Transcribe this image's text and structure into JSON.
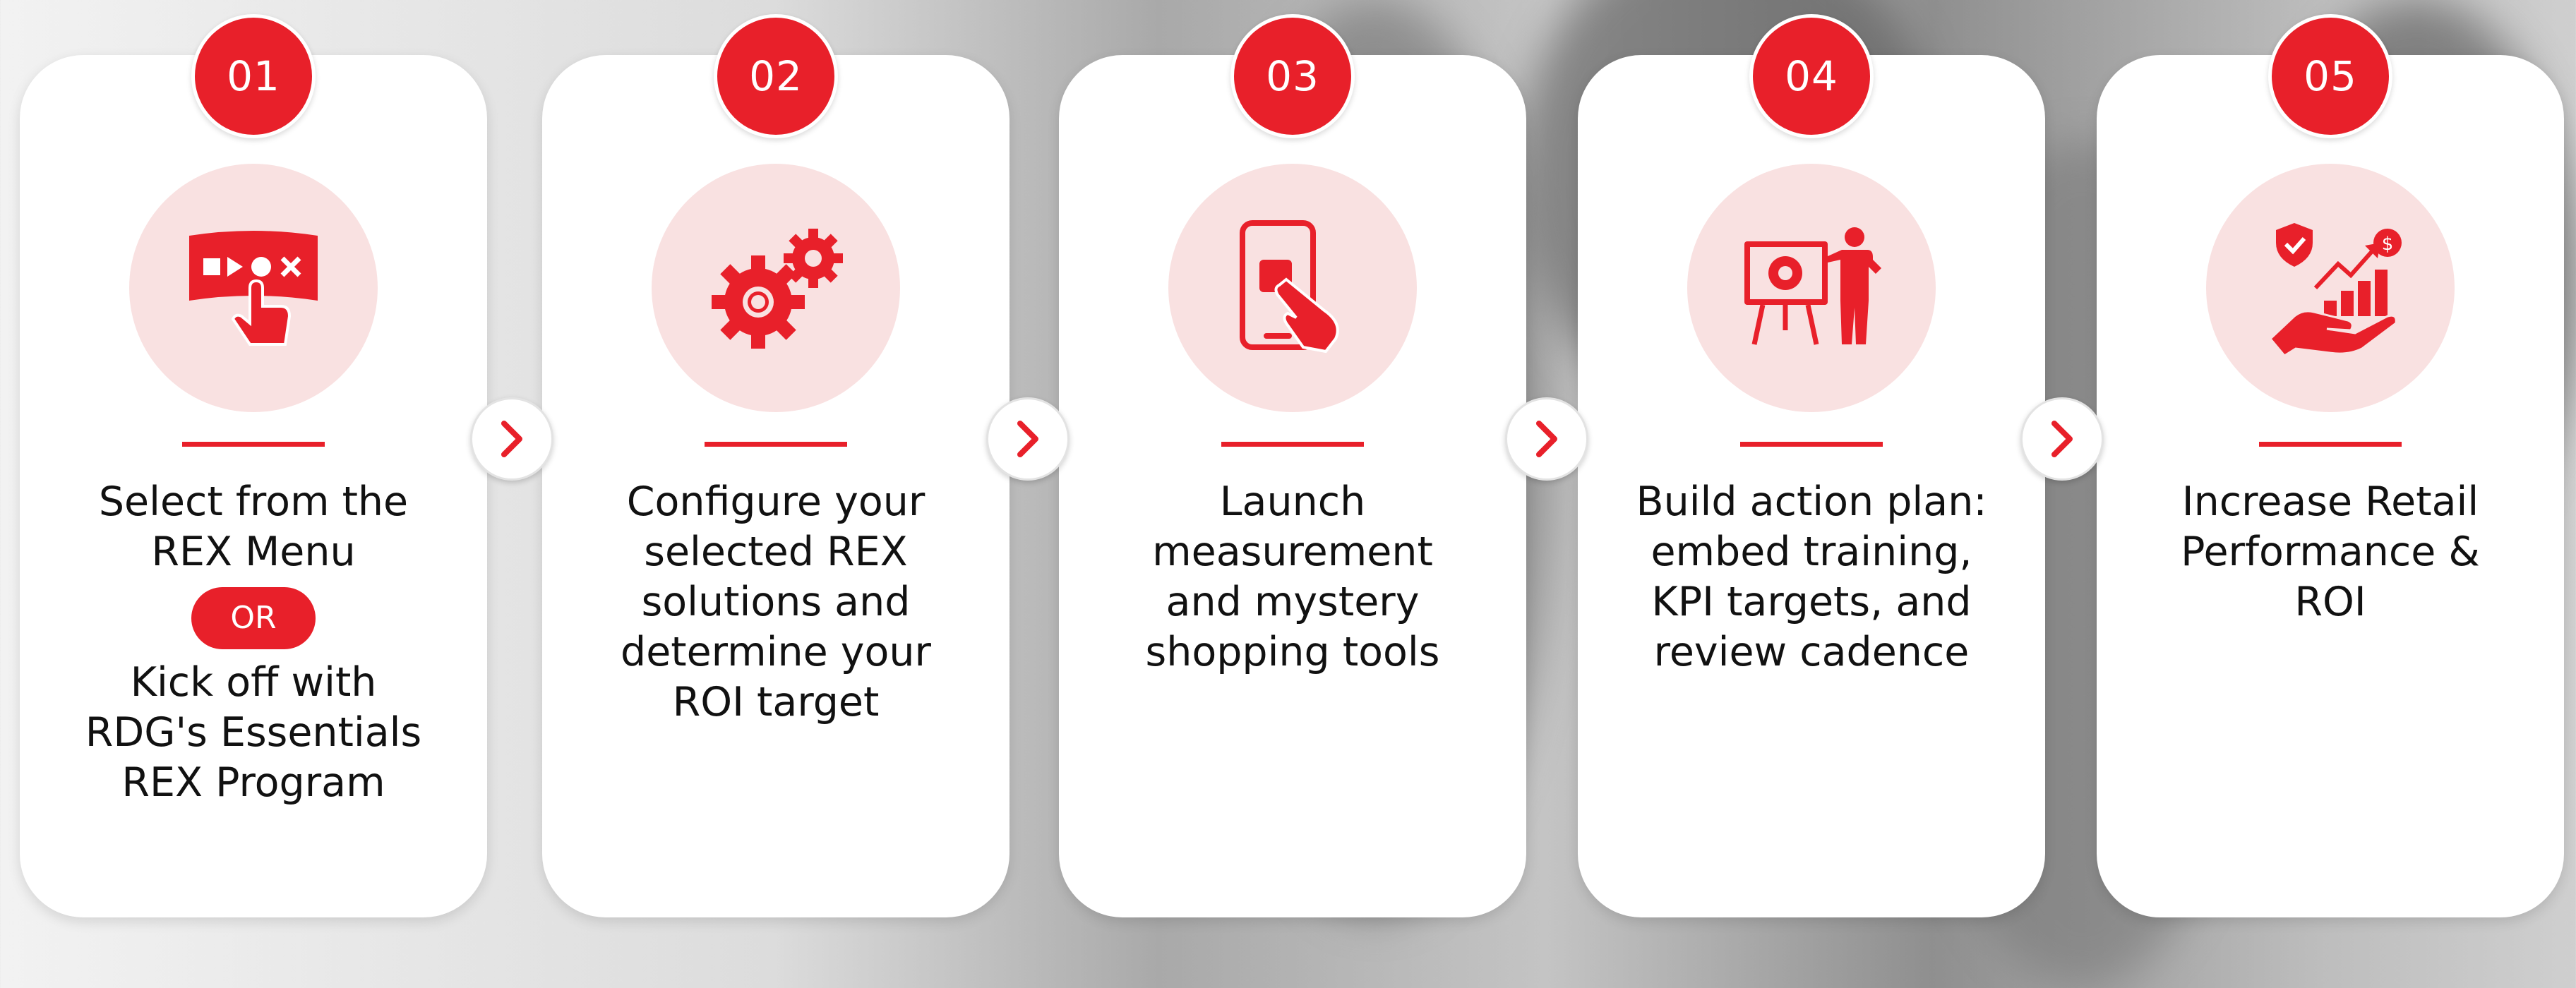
{
  "accent_color": "#e8202a",
  "steps": [
    {
      "number": "01",
      "icon": "touch-menu-icon",
      "lines": [
        "Select from the",
        "REX Menu"
      ],
      "or_label": "OR",
      "lines_after": [
        "Kick off with",
        "RDG's Essentials",
        "REX Program"
      ]
    },
    {
      "number": "02",
      "icon": "gears-icon",
      "lines": [
        "Configure your",
        "selected REX",
        "solutions and",
        "determine your",
        "ROI target"
      ]
    },
    {
      "number": "03",
      "icon": "phone-tap-icon",
      "lines": [
        "Launch",
        "measurement",
        "and mystery",
        "shopping tools"
      ]
    },
    {
      "number": "04",
      "icon": "presentation-icon",
      "lines": [
        "Build action plan:",
        "embed training,",
        "KPI targets, and",
        "review cadence"
      ]
    },
    {
      "number": "05",
      "icon": "growth-hand-icon",
      "lines": [
        "Increase Retail",
        "Performance &",
        "ROI"
      ]
    }
  ],
  "arrows": [
    {
      "icon": "chevron-right-icon"
    },
    {
      "icon": "chevron-right-icon"
    },
    {
      "icon": "chevron-right-icon"
    },
    {
      "icon": "chevron-right-icon"
    }
  ]
}
